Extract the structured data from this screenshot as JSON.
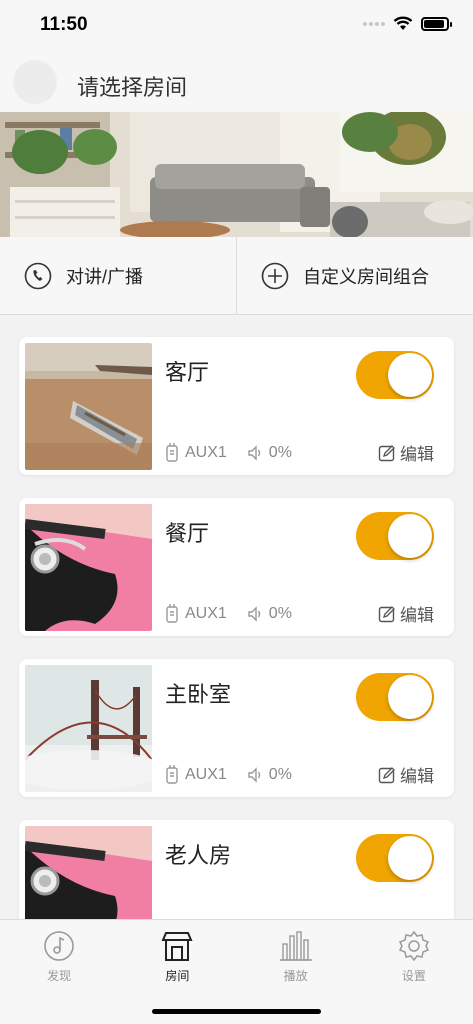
{
  "status_bar": {
    "time": "11:50"
  },
  "header": {
    "title": "请选择房间"
  },
  "actions": [
    {
      "label": "对讲/广播",
      "icon": "phone-icon"
    },
    {
      "label": "自定义房间组合",
      "icon": "plus-circle-icon"
    }
  ],
  "rooms": [
    {
      "name": "客厅",
      "source": "AUX1",
      "volume": "0%",
      "edit_label": "编辑",
      "enabled": true,
      "thumb": "boat-on-beach"
    },
    {
      "name": "餐厅",
      "source": "AUX1",
      "volume": "0%",
      "edit_label": "编辑",
      "enabled": true,
      "thumb": "headphone-girl"
    },
    {
      "name": "主卧室",
      "source": "AUX1",
      "volume": "0%",
      "edit_label": "编辑",
      "enabled": true,
      "thumb": "golden-gate-fog"
    },
    {
      "name": "老人房",
      "enabled": true,
      "thumb": "headphone-girl"
    }
  ],
  "tabs": [
    {
      "label": "发现",
      "icon": "music-disc-icon",
      "active": false
    },
    {
      "label": "房间",
      "icon": "house-icon",
      "active": true
    },
    {
      "label": "播放",
      "icon": "equalizer-bars-icon",
      "active": false
    },
    {
      "label": "设置",
      "icon": "gear-icon",
      "active": false
    }
  ],
  "colors": {
    "accent": "#f0a500",
    "background": "#f2f2f2",
    "card": "#ffffff"
  }
}
